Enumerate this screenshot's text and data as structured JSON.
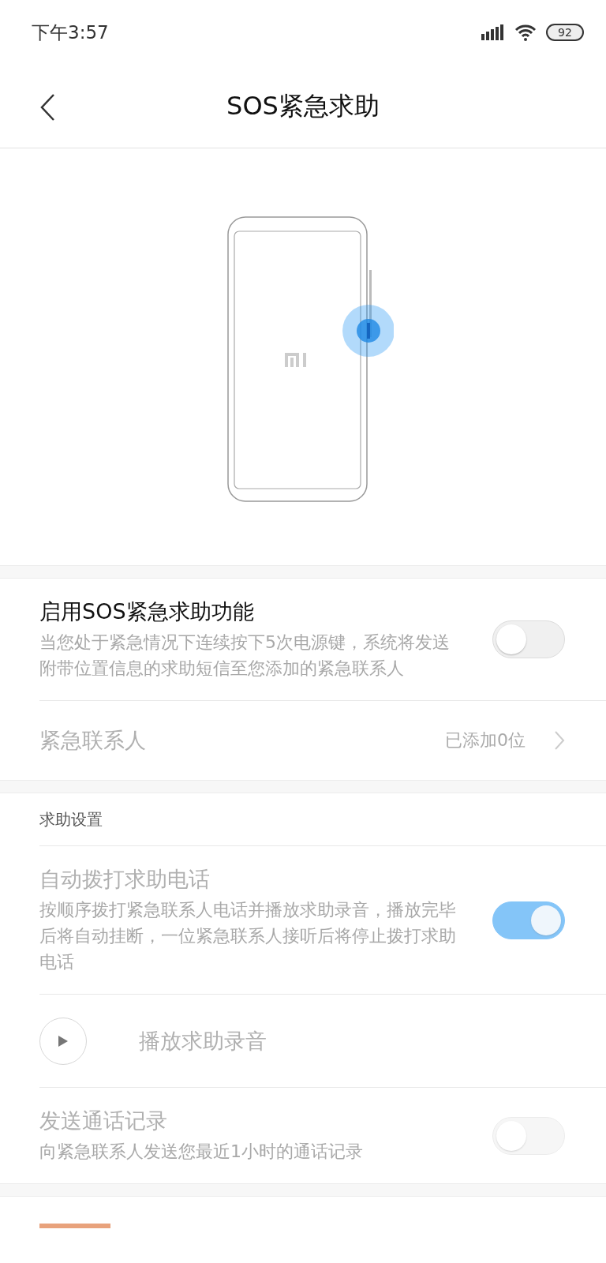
{
  "status_bar": {
    "time": "下午3:57",
    "battery": "92"
  },
  "header": {
    "title": "SOS紧急求助"
  },
  "main_section": {
    "rows": [
      {
        "kind": "switch",
        "title": "启用SOS紧急求助功能",
        "description": "当您处于紧急情况下连续按下5次电源键，系统将发送附带位置信息的求助短信至您添加的紧急联系人",
        "on": false,
        "disabled": false
      },
      {
        "kind": "link",
        "title": "紧急联系人",
        "value": "已添加0位",
        "disabled": true
      }
    ]
  },
  "help_settings": {
    "heading": "求助设置",
    "rows": [
      {
        "kind": "switch",
        "title": "自动拨打求助电话",
        "description": "按顺序拨打紧急联系人电话并播放求助录音，播放完毕后将自动挂断，一位紧急联系人接听后将停止拨打求助电话",
        "on": true,
        "disabled": true
      },
      {
        "kind": "play",
        "title": "播放求助录音",
        "disabled": true
      },
      {
        "kind": "switch",
        "title": "发送通话记录",
        "description": "向紧急联系人发送您最近1小时的通话记录",
        "on": false,
        "disabled": true
      }
    ]
  }
}
